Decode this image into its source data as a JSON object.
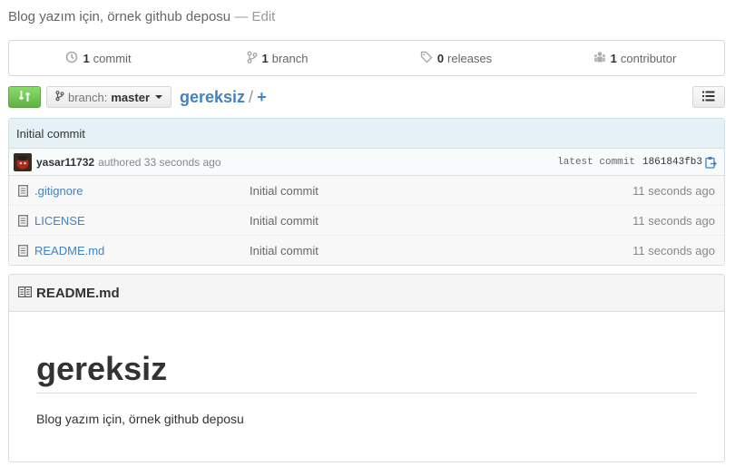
{
  "repo": {
    "description": "Blog yazım için, örnek github deposu",
    "separator": "—",
    "edit_label": "Edit"
  },
  "summary": {
    "commits": {
      "count": "1",
      "label": "commit"
    },
    "branches": {
      "count": "1",
      "label": "branch"
    },
    "releases": {
      "count": "0",
      "label": "releases"
    },
    "contributors": {
      "count": "1",
      "label": "contributor"
    }
  },
  "toolbar": {
    "branch_label": "branch:",
    "branch_name": "master",
    "repo_name": "gereksiz",
    "path_separator": "/",
    "add_label": "+"
  },
  "commit": {
    "message": "Initial commit",
    "author": "yasar11732",
    "authored": "authored 33 seconds ago",
    "latest_label": "latest commit",
    "sha": "1861843fb3"
  },
  "files": [
    {
      "name": ".gitignore",
      "message": "Initial commit",
      "age": "11 seconds ago"
    },
    {
      "name": "LICENSE",
      "message": "Initial commit",
      "age": "11 seconds ago"
    },
    {
      "name": "README.md",
      "message": "Initial commit",
      "age": "11 seconds ago"
    }
  ],
  "readme": {
    "filename": "README.md",
    "heading": "gereksiz",
    "body": "Blog yazım için, örnek github deposu"
  },
  "colors": {
    "link": "#4183c4",
    "compare_button": "#60b044",
    "commit_header_bg": "#e6f1f6"
  },
  "icons": {
    "commits": "history-icon",
    "branches": "git-branch-icon",
    "releases": "tag-icon",
    "contributors": "organization-icon",
    "compare": "compare-icon",
    "list": "list-icon",
    "copy": "clipboard-icon",
    "file": "file-text-icon",
    "readme": "book-icon"
  }
}
